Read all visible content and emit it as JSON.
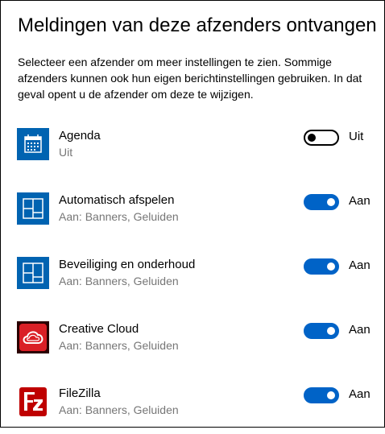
{
  "header": {
    "title": "Meldingen van deze afzenders ontvangen",
    "description": "Selecteer een afzender om meer instellingen te zien. Sommige afzenders kunnen ook hun eigen berichtinstellingen gebruiken. In dat geval opent u de afzender om deze te wijzigen."
  },
  "senders": [
    {
      "name": "Agenda",
      "status": "Uit",
      "toggle_on": false,
      "toggle_label": "Uit",
      "icon": "calendar-icon",
      "icon_color": "#0063b1"
    },
    {
      "name": "Automatisch afspelen",
      "status": "Aan: Banners, Geluiden",
      "toggle_on": true,
      "toggle_label": "Aan",
      "icon": "autoplay-icon",
      "icon_color": "#0063b1"
    },
    {
      "name": "Beveiliging en onderhoud",
      "status": "Aan: Banners, Geluiden",
      "toggle_on": true,
      "toggle_label": "Aan",
      "icon": "security-maintenance-icon",
      "icon_color": "#0063b1"
    },
    {
      "name": "Creative Cloud",
      "status": "Aan: Banners, Geluiden",
      "toggle_on": true,
      "toggle_label": "Aan",
      "icon": "creative-cloud-icon",
      "icon_color": "#da1f26"
    },
    {
      "name": "FileZilla",
      "status": "Aan: Banners, Geluiden",
      "toggle_on": true,
      "toggle_label": "Aan",
      "icon": "filezilla-icon",
      "icon_color": "#bf0000"
    }
  ],
  "colors": {
    "toggle_on": "#0063c7",
    "secondary_text": "#767676"
  }
}
